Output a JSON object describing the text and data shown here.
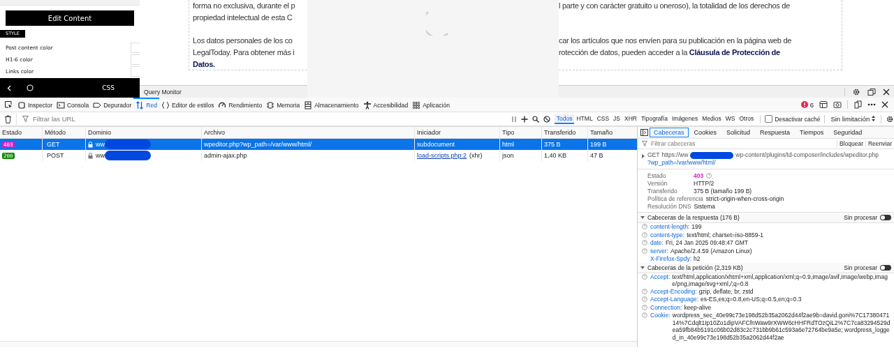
{
  "editor_panel": {
    "button": "Edit Content",
    "section": "STYLE",
    "color_options": [
      "Post content color",
      "H1-6 color",
      "Links color"
    ],
    "bottom_label": "CSS"
  },
  "article": {
    "left_paragraphs": [
      [
        "forma no exclusiva, durante el p",
        "propiedad intelectual de esta C"
      ],
      [
        "Los datos personales de los co",
        "LegalToday. Para obtener más i",
        "**Datos.**"
      ]
    ],
    "right_paragraphs": [
      [
        "l parte y con carácter gratuito u oneroso), la totalidad de los derechos de"
      ],
      [
        "car los artículos que nos envíen para su publicación en la página web de",
        "rotección de datos, pueden acceder a la **Cláusula de Protección de**"
      ]
    ]
  },
  "dock_bar": {
    "title": "Query Monitor"
  },
  "devtools": {
    "tools": [
      {
        "label": "Inspector",
        "selected": false
      },
      {
        "label": "Consola",
        "selected": false
      },
      {
        "label": "Depurador",
        "selected": false
      },
      {
        "label": "Red",
        "selected": true
      },
      {
        "label": "Editor de estilos",
        "selected": false
      },
      {
        "label": "Rendimiento",
        "selected": false
      },
      {
        "label": "Memoria",
        "selected": false
      },
      {
        "label": "Almacenamiento",
        "selected": false
      },
      {
        "label": "Accesibilidad",
        "selected": false
      },
      {
        "label": "Aplicación",
        "selected": false
      }
    ],
    "error_count": "6",
    "filter_placeholder": "Filtrar las URL",
    "type_filters": [
      {
        "label": "Todos",
        "selected": true
      },
      {
        "label": "HTML",
        "selected": false
      },
      {
        "label": "CSS",
        "selected": false
      },
      {
        "label": "JS",
        "selected": false
      },
      {
        "label": "XHR",
        "selected": false
      },
      {
        "label": "Tipografía",
        "selected": false
      },
      {
        "label": "Imágenes",
        "selected": false
      },
      {
        "label": "Medios",
        "selected": false
      },
      {
        "label": "WS",
        "selected": false
      },
      {
        "label": "Otros",
        "selected": false
      }
    ],
    "disable_cache": {
      "label": "Desactivar caché",
      "checked": false
    },
    "throttling": "Sin limitación",
    "table": {
      "columns": [
        "Estado",
        "Método",
        "Dominio",
        "Archivo",
        "Iniciador",
        "Tipo",
        "Transferido",
        "Tamaño"
      ],
      "rows": [
        {
          "status": "403",
          "color": "#d41ec8",
          "method": "GET",
          "domain": "ww",
          "file": "wpeditor.php?wp_path=/var/www/html/",
          "initiator": "subdocument",
          "initiator_note": "",
          "type": "html",
          "transferred": "375 B",
          "size": "199 B",
          "selected": true
        },
        {
          "status": "200",
          "color": "#0a8a00",
          "method": "POST",
          "domain": "ww",
          "file": "admin-ajax.php",
          "initiator": "load-scripts.php:2",
          "initiator_note": "(xhr)",
          "type": "json",
          "transferred": "1,40 KB",
          "size": "47 B",
          "selected": false
        }
      ]
    },
    "details": {
      "tabs": [
        {
          "label": "Cabeceras",
          "selected": true
        },
        {
          "label": "Cookies",
          "selected": false
        },
        {
          "label": "Solicitud",
          "selected": false
        },
        {
          "label": "Respuesta",
          "selected": false
        },
        {
          "label": "Tiempos",
          "selected": false
        },
        {
          "label": "Seguridad",
          "selected": false
        }
      ],
      "filter_placeholder": "Filtrar cabeceras",
      "actions": [
        "Bloquear",
        "Reenviar"
      ],
      "request_line": {
        "expanded": false,
        "method": "GET",
        "host": "https://ww",
        "path": "wp-content/plugins/td-composer/includes/wpeditor.php",
        "query": "?wp_path=/var/www/html/"
      },
      "summary": [
        {
          "label": "Estado",
          "value": "403",
          "kind": "status"
        },
        {
          "label": "Versión",
          "value": "HTTP/2",
          "kind": "text"
        },
        {
          "label": "Transferido",
          "value": "375 B (tamaño 199 B)",
          "kind": "text"
        },
        {
          "label": "Política de referencia",
          "value": "strict-origin-when-cross-origin",
          "kind": "text"
        },
        {
          "label": "Resolución DNS",
          "value": "Sistema",
          "kind": "text"
        }
      ],
      "sections": [
        {
          "title": "Cabeceras de la respuesta (176 B)",
          "expanded": true,
          "raw_label": "Sin procesar",
          "raw_on": false,
          "headers": [
            {
              "name": "content-length:",
              "value": "199",
              "help": true
            },
            {
              "name": "content-type:",
              "value": "text/html; charset=iso-8859-1",
              "help": true
            },
            {
              "name": "date:",
              "value": "Fri, 24 Jan 2025 09:48:47 GMT",
              "help": true
            },
            {
              "name": "server:",
              "value": "Apache/2.4.59 (Amazon Linux)",
              "help": true
            },
            {
              "name": "X-Firefox-Spdy:",
              "value": "h2",
              "help": false
            }
          ]
        },
        {
          "title": "Cabeceras de la petición (2,319 KB)",
          "expanded": true,
          "raw_label": "Sin procesar",
          "raw_on": false,
          "headers": [
            {
              "name": "Accept:",
              "value": "text/html,application/xhtml+xml,application/xml;q=0.9,image/avif,image/webp,image/png,image/svg+xml,*/*;q=0.8",
              "help": true
            },
            {
              "name": "Accept-Encoding:",
              "value": "gzip, deflate, br, zstd",
              "help": true
            },
            {
              "name": "Accept-Language:",
              "value": "es-ES,es;q=0.8,en-US;q=0.5,en;q=0.3",
              "help": true
            },
            {
              "name": "Connection:",
              "value": "keep-alive",
              "help": true
            },
            {
              "name": "Cookie:",
              "value": "wordpress_sec_40e99c73e198d52b35a2062d44f2ae9b=david.goni%7C1738047114%7Cdqlt1Ip10Zo1dipVAFCfnWaw9rXWW6cHHFRdTOzQiL2%7C7ca83294529dea59fb84b5191c06b02d83c2c731bb9b61c593a6e72764be9a5e; wordpress_logged_in_40e99c73e198d52b35a2062d44f2ae",
              "help": true
            }
          ]
        }
      ]
    }
  }
}
